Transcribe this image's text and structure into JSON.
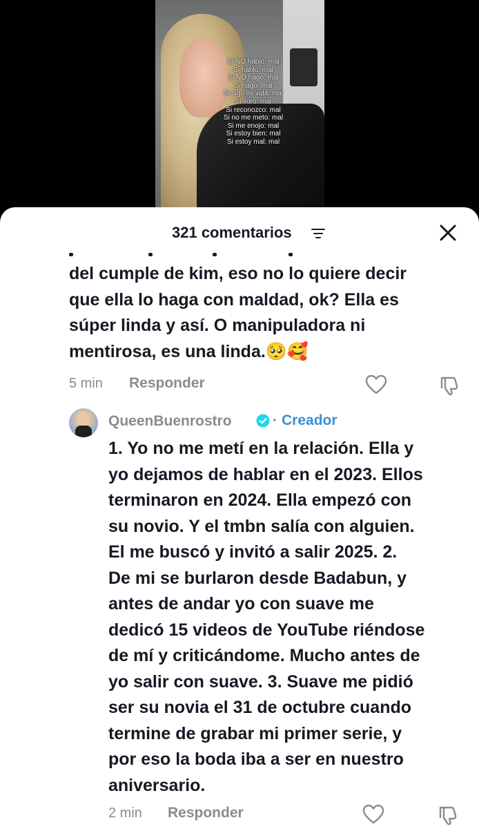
{
  "video": {
    "overlay_lines": [
      "Si NO hablo: mal",
      "Si hablo: mal",
      "Si NO hago: mal",
      "Si hago: mal",
      "Si sigo mi vida: mal",
      "Si lloro: mal",
      "Si reconozco: mal",
      "Si no me meto: mal",
      "Si me enojo: mal",
      "Si estoy bien: mal",
      "Si estoy mal: mal"
    ]
  },
  "header": {
    "count_label": "321 comentarios",
    "filter_icon": "filter-lines-icon",
    "close_icon": "close-icon"
  },
  "comments": [
    {
      "text_lines": [
        "del cumple de kim, eso no lo quiere decir",
        "que ella lo haga con maldad, ok? Ella es",
        "súper linda y así. O manipuladora ni",
        "mentirosa, es una linda.🥺🥰"
      ],
      "time": "5 min",
      "reply_label": "Responder"
    },
    {
      "username": "QueenBuenrostro",
      "separator": "·",
      "badge": "Creador",
      "text_lines": [
        "1. Yo no me metí en la relación. Ella y",
        "yo dejamos de hablar en el 2023. Ellos",
        "terminaron en 2024. Ella empezó con",
        "su novio. Y el tmbn salía con alguien.",
        "El me buscó y invitó a salir 2025. 2.",
        "De mi se burlaron desde Badabun, y",
        "antes de andar yo con suave me",
        "dedicó 15 videos de YouTube riéndose",
        "de mí y criticándome. Mucho antes de",
        "yo salir con suave. 3. Suave me pidió",
        "ser su novia el 31 de octubre cuando",
        "termine de grabar mi primer serie, y",
        "por eso la boda iba a ser en nuestro",
        "aniversario."
      ],
      "time": "2 min",
      "reply_label": "Responder"
    }
  ],
  "colors": {
    "text": "#161823",
    "muted": "#8a8b91",
    "creator": "#3e8fd1",
    "verified": "#20d5ec"
  }
}
